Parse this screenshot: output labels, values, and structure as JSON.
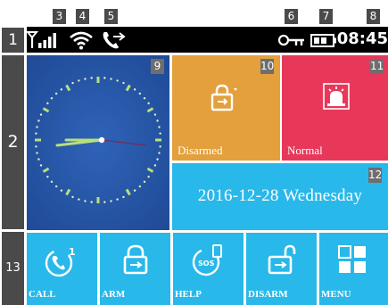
{
  "annotations": {
    "badges": [
      "1",
      "2",
      "3",
      "4",
      "5",
      "6",
      "7",
      "8",
      "9",
      "10",
      "11",
      "12",
      "13"
    ]
  },
  "statusbar": {
    "time": "08:45",
    "icons": [
      "signal-icon",
      "wifi-icon",
      "call-forward-icon",
      "key-icon",
      "battery-icon"
    ]
  },
  "tiles": {
    "arm_status": {
      "label": "Disarmed",
      "icon": "lock-icon",
      "color": "#e3a03d"
    },
    "alarm_status": {
      "label": "Normal",
      "icon": "siren-icon",
      "color": "#e8385a"
    },
    "date": {
      "text": "2016-12-28 Wednesday",
      "color": "#29b8ea"
    },
    "clock": {
      "icon": "analog-clock",
      "color": "#2556a8"
    }
  },
  "nav": [
    {
      "label": "CALL",
      "icon": "phone-icon"
    },
    {
      "label": "ARM",
      "icon": "lock-closed-icon"
    },
    {
      "label": "HELP",
      "icon": "sos-icon"
    },
    {
      "label": "DISARM",
      "icon": "lock-open-icon"
    },
    {
      "label": "MENU",
      "icon": "grid-menu-icon"
    }
  ],
  "colors": {
    "nav_background": "#29b8ea",
    "statusbar_background": "#000000"
  }
}
